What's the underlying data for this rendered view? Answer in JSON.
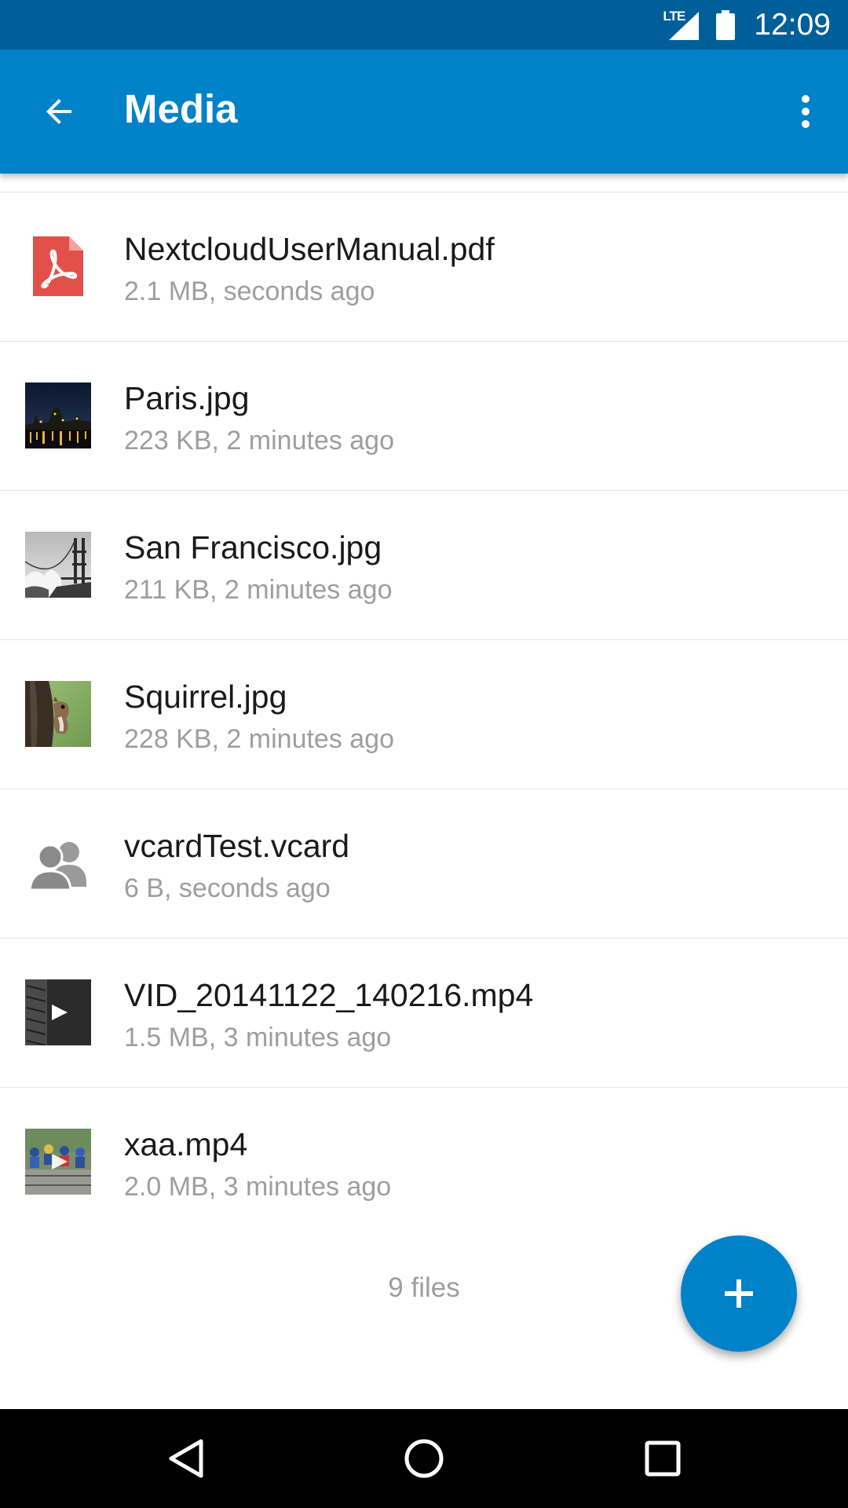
{
  "status_bar": {
    "network": "LTE",
    "time": "12:09"
  },
  "app_bar": {
    "title": "Media",
    "back_icon": "arrow-back-icon",
    "menu_icon": "more-vert-icon"
  },
  "files": [
    {
      "name": "NextcloudUserManual.pdf",
      "meta": "2.1 MB, seconds ago",
      "icon": "pdf-icon"
    },
    {
      "name": "Paris.jpg",
      "meta": "223 KB, 2 minutes ago",
      "icon": "image-thumbnail"
    },
    {
      "name": "San Francisco.jpg",
      "meta": "211 KB, 2 minutes ago",
      "icon": "image-thumbnail"
    },
    {
      "name": "Squirrel.jpg",
      "meta": "228 KB, 2 minutes ago",
      "icon": "image-thumbnail"
    },
    {
      "name": "vcardTest.vcard",
      "meta": "6 B, seconds ago",
      "icon": "contacts-icon"
    },
    {
      "name": "VID_20141122_140216.mp4",
      "meta": "1.5 MB, 3 minutes ago",
      "icon": "video-thumbnail"
    },
    {
      "name": "xaa.mp4",
      "meta": "2.0 MB, 3 minutes ago",
      "icon": "video-thumbnail"
    }
  ],
  "footer": {
    "count_label": "9 files"
  },
  "fab": {
    "icon": "plus-icon"
  },
  "nav_bar": {
    "back_icon": "nav-back-icon",
    "home_icon": "nav-home-icon",
    "recents_icon": "nav-recents-icon"
  },
  "colors": {
    "status_bar": "#005f99",
    "app_bar": "#0082c9",
    "fab": "#0082c9",
    "primary_text": "#1a1a1a",
    "secondary_text": "#9e9e9e",
    "pdf_red": "#e2504a"
  }
}
